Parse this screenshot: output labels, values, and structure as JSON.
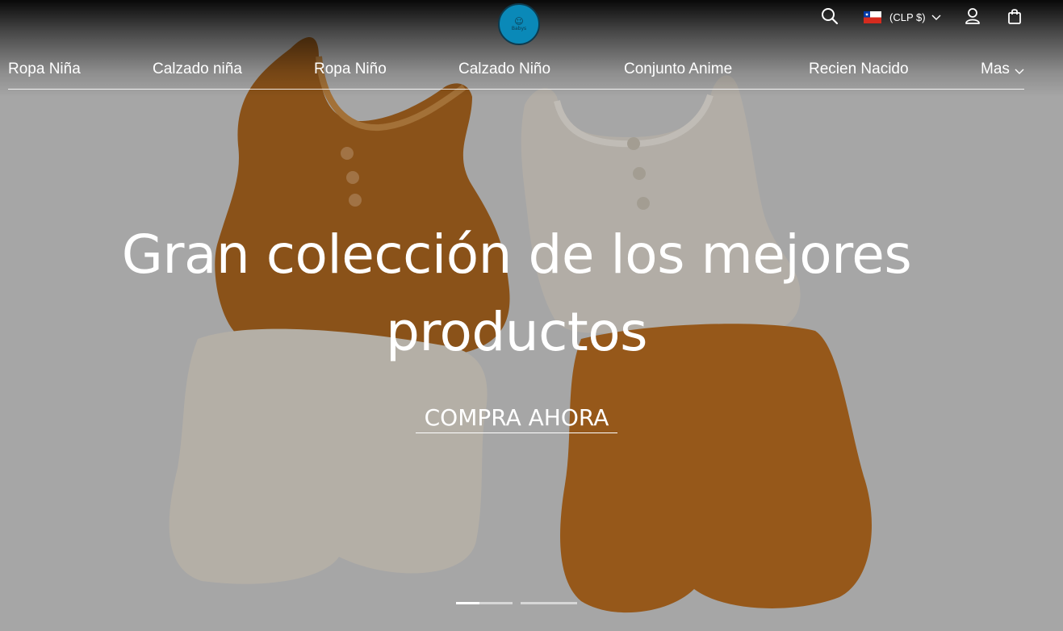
{
  "header": {
    "logo_alt": "Babys",
    "currency": {
      "label": "(CLP $)",
      "flag": "chile-flag-icon"
    },
    "icons": [
      "search-icon",
      "chevron-down-icon",
      "user-icon",
      "shopping-bag-icon"
    ]
  },
  "nav": {
    "items": [
      {
        "label": "Ropa Niña"
      },
      {
        "label": "Calzado niña"
      },
      {
        "label": "Ropa Niño"
      },
      {
        "label": "Calzado Niño"
      },
      {
        "label": "Conjunto Anime"
      },
      {
        "label": "Recien Nacido"
      },
      {
        "label": "Mas"
      }
    ]
  },
  "hero": {
    "headline_line1": "Gran colección de los mejores",
    "headline_line2": "productos",
    "cta_label": "COMPRA AHORA",
    "slider": {
      "slide_count": 2,
      "active_index": 0,
      "active_progress": 0.42
    }
  },
  "colors": {
    "logo_bg": "#0a89b8",
    "text": "#ffffff",
    "hero_bg": "#cbcbcb",
    "garment_orange": "#b06b22",
    "garment_cream": "#d8d2c6"
  }
}
